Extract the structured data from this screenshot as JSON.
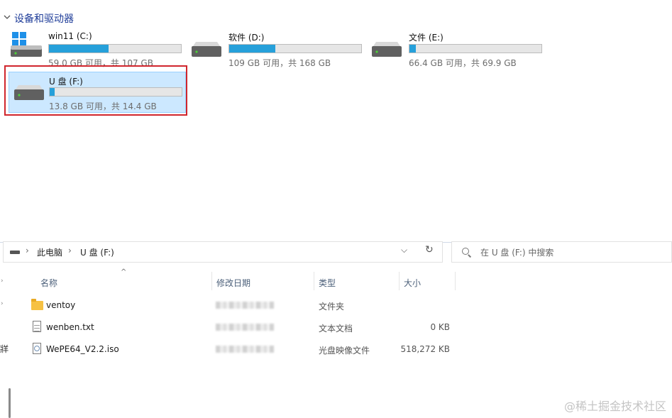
{
  "section": {
    "title": "设备和驱动器"
  },
  "drives": [
    {
      "name": "win11 (C:)",
      "space_text": "59.0 GB 可用，共 107 GB",
      "used_fraction": 0.45,
      "icon": "windows-drive-icon"
    },
    {
      "name": "软件 (D:)",
      "space_text": "109 GB 可用，共 168 GB",
      "used_fraction": 0.35,
      "icon": "hard-drive-icon"
    },
    {
      "name": "文件 (E:)",
      "space_text": "66.4 GB 可用，共 69.9 GB",
      "used_fraction": 0.05,
      "icon": "hard-drive-icon"
    },
    {
      "name": "U 盘 (F:)",
      "space_text": "13.8 GB 可用，共 14.4 GB",
      "used_fraction": 0.04,
      "icon": "usb-drive-icon",
      "selected": true
    }
  ],
  "address": {
    "crumbs": [
      "此电脑",
      "U 盘 (F:)"
    ],
    "dropdown_glyph": "⌵",
    "refresh_glyph": "↻"
  },
  "search": {
    "placeholder": "在 U 盘 (F:) 中搜索"
  },
  "columns": {
    "name": "名称",
    "date": "修改日期",
    "type": "类型",
    "size": "大小"
  },
  "files": [
    {
      "name": "ventoy",
      "type": "文件夹",
      "size": "",
      "icon": "folder-icon"
    },
    {
      "name": "wenben.txt",
      "type": "文本文档",
      "size": "0 KB",
      "icon": "text-file-icon"
    },
    {
      "name": "WePE64_V2.2.iso",
      "type": "光盘映像文件",
      "size": "518,272 KB",
      "icon": "iso-file-icon"
    }
  ],
  "nav": {
    "partial_char": "牂"
  },
  "watermark": "@稀土掘金技术社区",
  "colors": {
    "accent_fill": "#26a0da",
    "selection_bg": "#cce8ff",
    "highlight_border": "#d0262d"
  }
}
